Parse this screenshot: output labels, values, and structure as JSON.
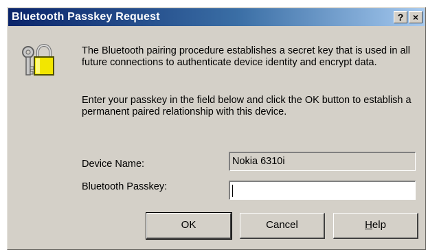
{
  "window": {
    "title": "Bluetooth Passkey Request",
    "help_glyph": "?",
    "close_glyph": "×"
  },
  "body": {
    "paragraph1": "The Bluetooth pairing procedure establishes a secret key that is used in all future connections to authenticate device identity and encrypt data.",
    "paragraph2": "Enter your passkey in the field below and click the OK button to establish a permanent paired relationship with this device."
  },
  "form": {
    "device_name_label": "Device Name:",
    "device_name_value": "Nokia 6310i",
    "passkey_label": "Bluetooth Passkey:",
    "passkey_value": ""
  },
  "buttons": {
    "ok": "OK",
    "cancel": "Cancel",
    "help_first": "H",
    "help_rest": "elp"
  },
  "colors": {
    "title_start": "#0a246a",
    "title_end": "#a6caf0",
    "face": "#d4d0c8",
    "lock": "#f2e600"
  },
  "icons": [
    "lock-key-icon",
    "help-icon",
    "close-icon"
  ]
}
